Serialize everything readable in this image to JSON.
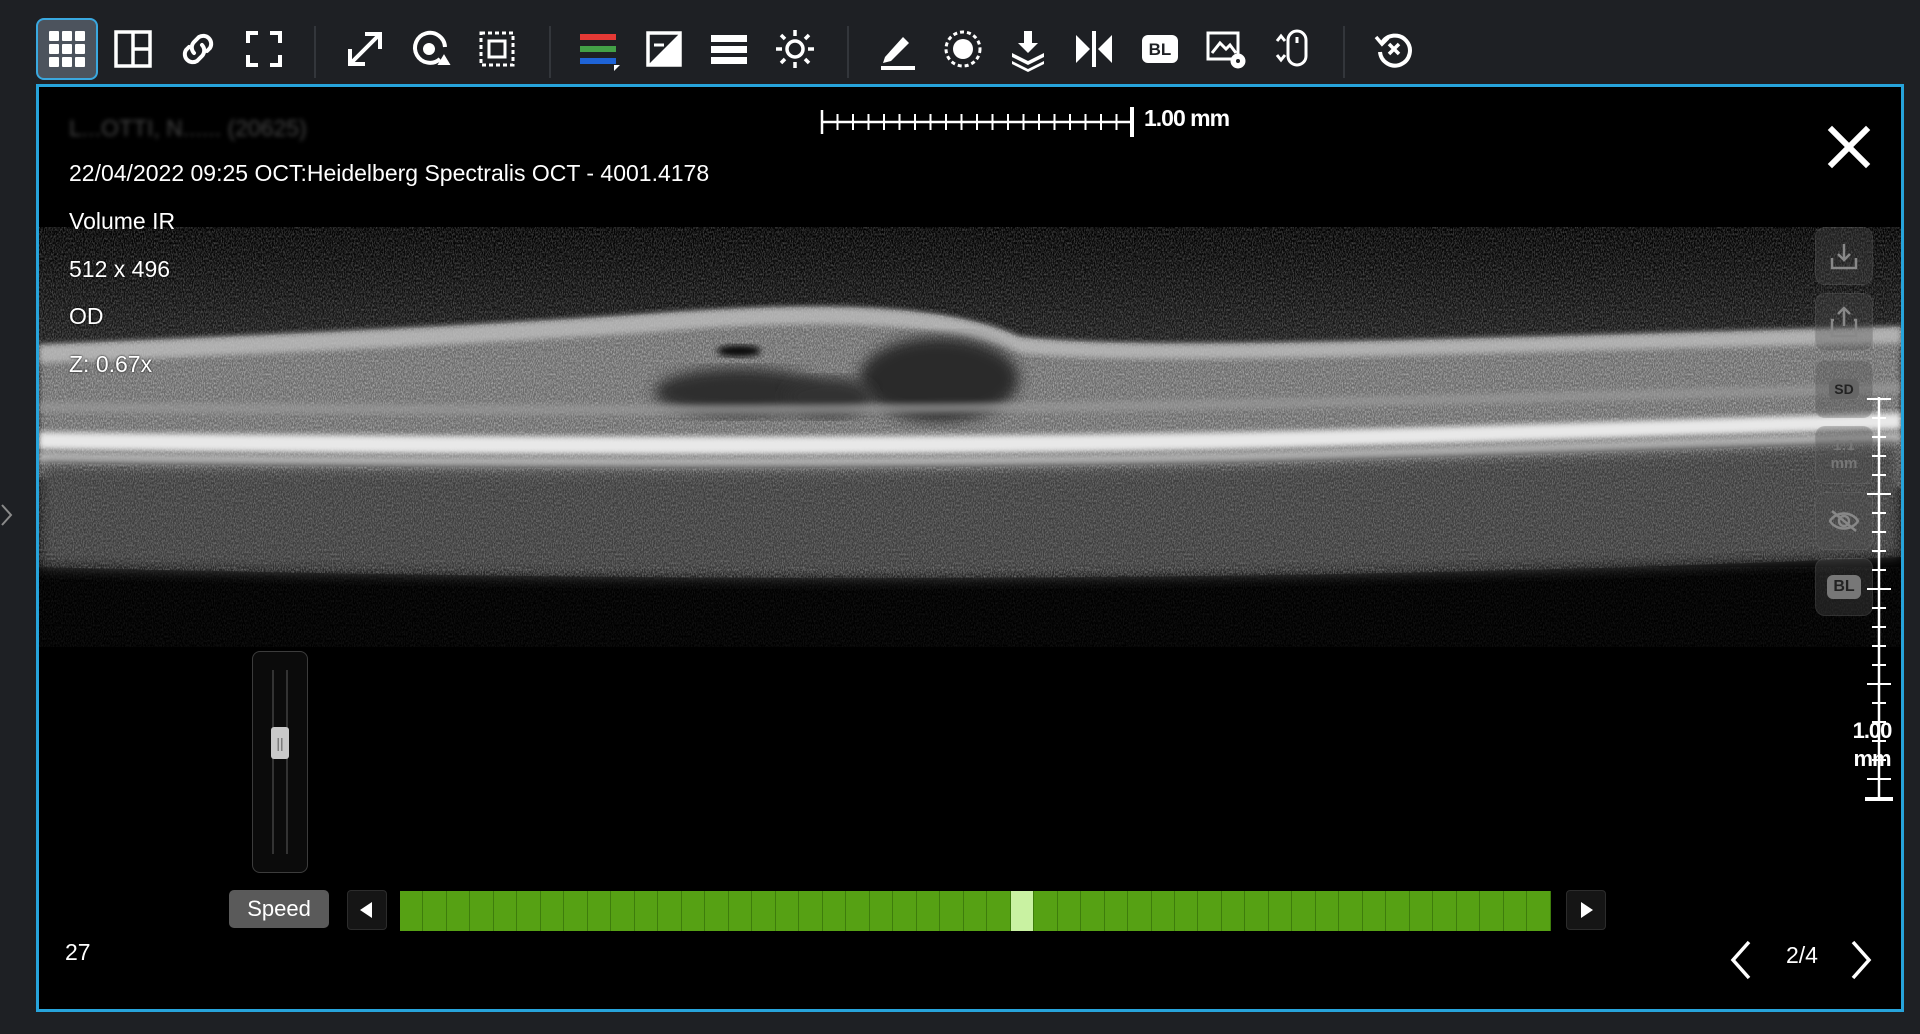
{
  "toolbar": {
    "items": [
      {
        "name": "grid-layout-button",
        "icon": "grid-icon",
        "active": true
      },
      {
        "name": "split-layout-button",
        "icon": "split-panel-icon"
      },
      {
        "name": "link-button",
        "icon": "link-icon"
      },
      {
        "name": "fullscreen-button",
        "icon": "fullscreen-icon"
      },
      {
        "name": "fit-button",
        "icon": "diagonal-expand-icon"
      },
      {
        "name": "zoom-rotate-button",
        "icon": "zoom-rotate-icon"
      },
      {
        "name": "crop-button",
        "icon": "crop-icon"
      },
      {
        "name": "color-channels-button",
        "icon": "rgb-channels-icon"
      },
      {
        "name": "invert-button",
        "icon": "invert-icon"
      },
      {
        "name": "lines-button",
        "icon": "lines-icon"
      },
      {
        "name": "brightness-button",
        "icon": "brightness-icon"
      },
      {
        "name": "annotate-button",
        "icon": "pencil-icon"
      },
      {
        "name": "region-button",
        "icon": "circle-target-icon"
      },
      {
        "name": "layers-button",
        "icon": "layers-download-icon"
      },
      {
        "name": "compare-button",
        "icon": "compare-icon"
      },
      {
        "name": "baseline-button",
        "icon": "bl-icon",
        "label": "BL"
      },
      {
        "name": "settings-button",
        "icon": "image-settings-icon"
      },
      {
        "name": "mouse-scroll-button",
        "icon": "mouse-scroll-icon"
      },
      {
        "name": "reset-button",
        "icon": "reset-icon"
      }
    ]
  },
  "viewer": {
    "patient_name": "L...OTTI, N...... (20625)",
    "exam_line": "22/04/2022 09:25 OCT:Heidelberg Spectralis OCT - 4001.4178",
    "series": "Volume IR",
    "dimensions": "512 x 496",
    "eye": "OD",
    "zoom": "Z: 0.67x",
    "h_scale_label": "1.00 mm",
    "v_scale_label_line1": "1.00",
    "v_scale_label_line2": "mm",
    "side_tools": {
      "sd_label": "SD",
      "ratio_line1": "1:1",
      "ratio_line2": "mm",
      "bl_label": "BL"
    },
    "speed_label": "Speed",
    "speed_level": 0.62,
    "frames_total": 49,
    "current_frame_index": 26,
    "slice_number": "27",
    "page_indicator": "2/4"
  },
  "colors": {
    "accent": "#27a4db",
    "frame_green": "#56a114",
    "frame_current": "#c9f2a2"
  }
}
